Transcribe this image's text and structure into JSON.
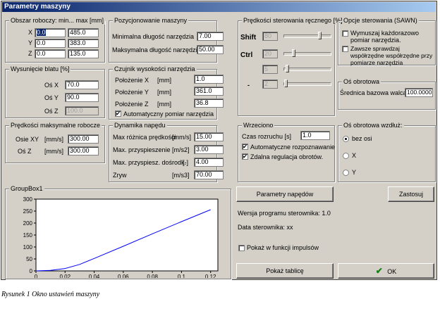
{
  "window": {
    "title": "Parametry maszyny"
  },
  "work_area": {
    "title": "Obszar roboczy: min... max  [mm]",
    "rows": [
      {
        "axis": "X",
        "min": "0.0",
        "max": "485.0"
      },
      {
        "axis": "Y",
        "min": "0.0",
        "max": "383.0"
      },
      {
        "axis": "Z",
        "min": "0.0",
        "max": "135.0"
      }
    ]
  },
  "table_extension": {
    "title": "Wysunięcie blatu [%]",
    "rows": [
      {
        "label": "Oś X",
        "value": "70.0"
      },
      {
        "label": "Oś Y",
        "value": "90.0"
      },
      {
        "label": "Oś Z",
        "value": "100.0"
      }
    ]
  },
  "max_speeds": {
    "title": "Prędkości maksymalne robocze",
    "rows": [
      {
        "label": "Osie XY",
        "unit": "[mm/s]",
        "value": "300.00"
      },
      {
        "label": "Oś Z",
        "unit": "[mm/s]",
        "value": "300.00"
      }
    ]
  },
  "positioning": {
    "title": "Pozycjonowanie maszyny",
    "min_label": "Minimalna długość narzędzia",
    "min_value": "7.00",
    "max_label": "Maksymalna długość narzędzia",
    "max_value": "50.00"
  },
  "tool_sensor": {
    "title": "Czujnik wysokości narzędzia",
    "rows": [
      {
        "label": "Położenie X",
        "unit": "[mm]",
        "value": "1.0"
      },
      {
        "label": "Położenie Y",
        "unit": "[mm]",
        "value": "361.0"
      },
      {
        "label": "Położenie Z",
        "unit": "[mm]",
        "value": "36.8"
      }
    ],
    "auto_label": "Automatyczny pomiar narzędzia"
  },
  "drive_dynamics": {
    "title": "Dynamika napędu",
    "rows": [
      {
        "label": "Max różnica prędkości",
        "unit": "[mm/s]",
        "value": "15.00"
      },
      {
        "label": "Max. przyspieszenie",
        "unit": "[m/s2]",
        "value": "3.00"
      },
      {
        "label": "Max. przyspiesz. dośrodk.",
        "unit": "[-]",
        "value": "4.00"
      },
      {
        "label": "Zryw",
        "unit": "[m/s3]",
        "value": "70.00"
      }
    ]
  },
  "manual_speeds": {
    "title": "Prędkości sterowania ręcznego [%]",
    "rows": [
      {
        "label": "Shift",
        "value": "80",
        "level": 0.8
      },
      {
        "label": "Ctrl",
        "value": "20",
        "level": 0.2
      },
      {
        "label": "",
        "value": "5",
        "level": 0.05
      },
      {
        "label": "-",
        "value": "2",
        "level": 0.02
      }
    ]
  },
  "control_options": {
    "title": "Opcje sterowania (SAWN)",
    "opt1": "Wymuszaj każdorazowo pomiar narzędzia.",
    "opt2": "Zawsze sprawdzaj współrzędne współrzędne przy pomiarze narzędzia"
  },
  "rotation_axis": {
    "title": "Oś obrotowa",
    "label": "Średnica bazowa walca",
    "value": "100.0000"
  },
  "spindle": {
    "title": "Wrzeciono",
    "spinup_label": "Czas rozruchu [s]",
    "spinup_value": "1.0",
    "auto_label": "Automatyczne rozpoznawanie",
    "remote_label": "Zdalna regulacja obrotów."
  },
  "rotation_along": {
    "title": "Oś obrotowa wzdłuż:",
    "options": [
      "bez osi",
      "X",
      "Y"
    ]
  },
  "chart_group": {
    "title": "GroupBox1"
  },
  "chart_data": {
    "type": "line",
    "x": [
      0,
      0.01,
      0.02,
      0.03,
      0.04,
      0.06,
      0.08,
      0.1,
      0.12
    ],
    "y": [
      0,
      2,
      10,
      27,
      52,
      103,
      155,
      206,
      256
    ],
    "xticks": [
      "0",
      "0.02",
      "0.04",
      "0.06",
      "0.08",
      "0.1",
      "0.12"
    ],
    "yticks": [
      "0",
      "50",
      "100",
      "150",
      "200",
      "250",
      "300"
    ],
    "xlim": [
      0,
      0.125
    ],
    "ylim": [
      0,
      300
    ],
    "color": "#0000ff"
  },
  "buttons": {
    "drive_params": "Parametry napędów",
    "apply": "Zastosuj",
    "show_table": "Pokaż tablicę",
    "ok": "OK"
  },
  "info": {
    "version": "Wersja programu sterownika: 1.0",
    "date": "Data sterownika: xx",
    "impulse": "Pokaż w funkcji impulsów"
  },
  "caption": "Rysunek 1 Okno ustawień maszyny"
}
